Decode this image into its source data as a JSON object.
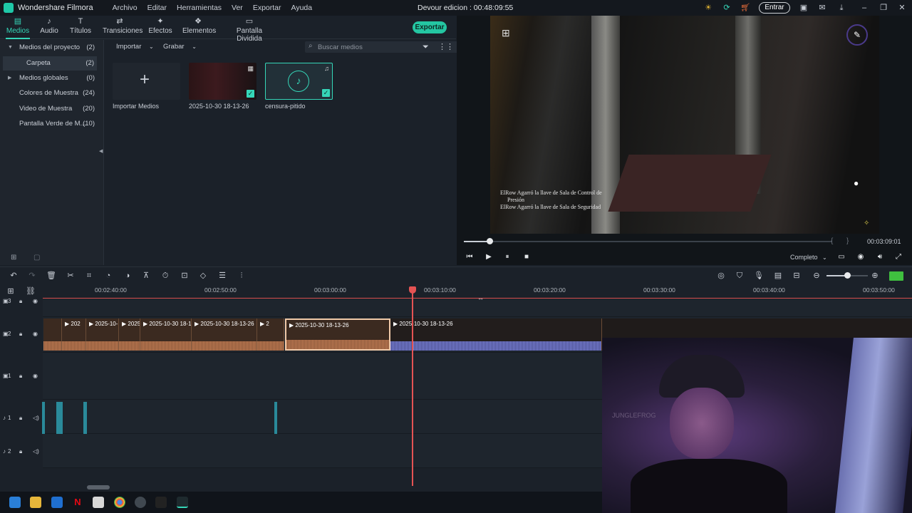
{
  "app": {
    "name": "Wondershare Filmora",
    "menu": [
      "Archivo",
      "Editar",
      "Herramientas",
      "Ver",
      "Exportar",
      "Ayuda"
    ],
    "project_title": "Devour edicion : 00:48:09:55",
    "login_label": "Entrar"
  },
  "tabs": [
    {
      "label": "Medios",
      "icon": "media-icon"
    },
    {
      "label": "Audio",
      "icon": "music-note-icon"
    },
    {
      "label": "Títulos",
      "icon": "text-t-icon"
    },
    {
      "label": "Transiciones",
      "icon": "transition-icon"
    },
    {
      "label": "Efectos",
      "icon": "sparkle-icon"
    },
    {
      "label": "Elementos",
      "icon": "elements-icon"
    },
    {
      "label": "Pantalla Dividida",
      "icon": "split-screen-icon"
    }
  ],
  "export_label": "Exportar",
  "sidebar": {
    "items": [
      {
        "label": "Medios del proyecto",
        "count": "(2)"
      },
      {
        "label": "Carpeta",
        "count": "(2)"
      },
      {
        "label": "Medios globales",
        "count": "(0)"
      },
      {
        "label": "Colores de Muestra",
        "count": "(24)"
      },
      {
        "label": "Video de Muestra",
        "count": "(20)"
      },
      {
        "label": "Pantalla Verde de M...",
        "count": "(10)"
      }
    ]
  },
  "media": {
    "import_label": "Importar",
    "record_label": "Grabar",
    "search_placeholder": "Buscar medios",
    "items": [
      {
        "label": "Importar Medios"
      },
      {
        "label": "2025-10-30 18-13-26"
      },
      {
        "label": "censura-pitido"
      }
    ]
  },
  "preview": {
    "subtitles": [
      "ElRow Agarró la llave de Sala de Control de",
      "Presión",
      "ElRow Agarró la llave de Sala de Seguridad"
    ],
    "timecode": "00:03:09:01",
    "quality": "Completo",
    "progress": 0.07
  },
  "timeline": {
    "ruler": [
      "00:02:40:00",
      "00:02:50:00",
      "00:03:00:00",
      "00:03:10:00",
      "00:03:20:00",
      "00:03:30:00",
      "00:03:40:00",
      "00:03:50:00"
    ],
    "tracks": [
      "3",
      "2",
      "1",
      "1",
      "2"
    ],
    "clips": [
      {
        "label": ""
      },
      {
        "label": "202"
      },
      {
        "label": "2025-10-"
      },
      {
        "label": "2025"
      },
      {
        "label": "2025-10-30 18-1"
      },
      {
        "label": "2025-10-30 18-13-26"
      },
      {
        "label": "2"
      },
      {
        "label": "2025-10-30 18-13-26"
      },
      {
        "label": "2025-10-30 18-13-26"
      }
    ]
  },
  "webcam_text": "JUNGLEFROG"
}
